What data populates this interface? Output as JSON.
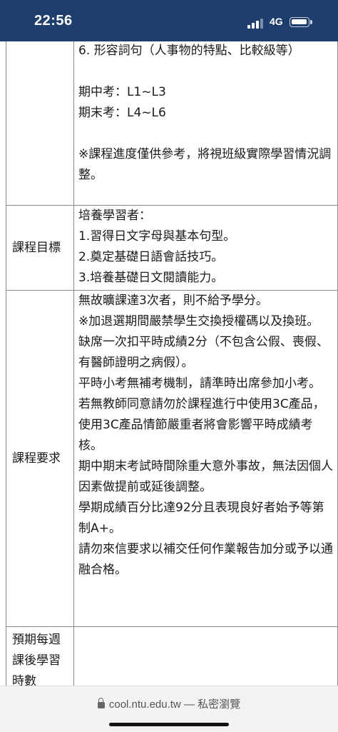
{
  "status_bar": {
    "time": "22:56",
    "network": "4G",
    "signal_bars_filled": 3,
    "signal_bars_total": 4
  },
  "rows": [
    {
      "label": "",
      "paragraphs": [
        "6. 形容詞句（人事物的特點、比較級等）",
        "",
        "期中考：L1~L3",
        "期末考：L4~L6",
        "",
        "※課程進度僅供參考，將視班級實際學習情況調整。"
      ]
    },
    {
      "label": "課程目標",
      "paragraphs": [
        "培養學習者：",
        "1.習得日文字母與基本句型。",
        "2.奠定基礎日語會話技巧。",
        "3.培養基礎日文閱讀能力。"
      ]
    },
    {
      "label": "課程要求",
      "paragraphs": [
        "無故曠課達3次者，則不給予學分。",
        "※加退選期間嚴禁學生交換授權碼以及換班。",
        "缺席一次扣平時成績2分（不包含公假、喪假、有醫師證明之病假）。",
        "平時小考無補考機制，請準時出席參加小考。",
        "若無教師同意請勿於課程進行中使用3C產品，使用3C產品情節嚴重者將會影響平時成績考核。",
        "期中期末考試時間除重大意外事故，無法因個人因素做提前或延後調整。",
        "學期成績百分比達92分且表現良好者始予等第制A+。",
        "請勿來信要求以補交任何作業報告加分或予以通融合格。"
      ]
    },
    {
      "label": "預期每週課後學習時數",
      "paragraphs": []
    }
  ],
  "browser": {
    "url": "cool.ntu.edu.tw",
    "separator": "—",
    "mode": "私密瀏覽",
    "lock_icon": "lock-icon"
  },
  "colors": {
    "status_bar_bg": "#1e3f6e",
    "border": "#8a8a8a",
    "url_bar_bg": "#f2f2f2"
  }
}
